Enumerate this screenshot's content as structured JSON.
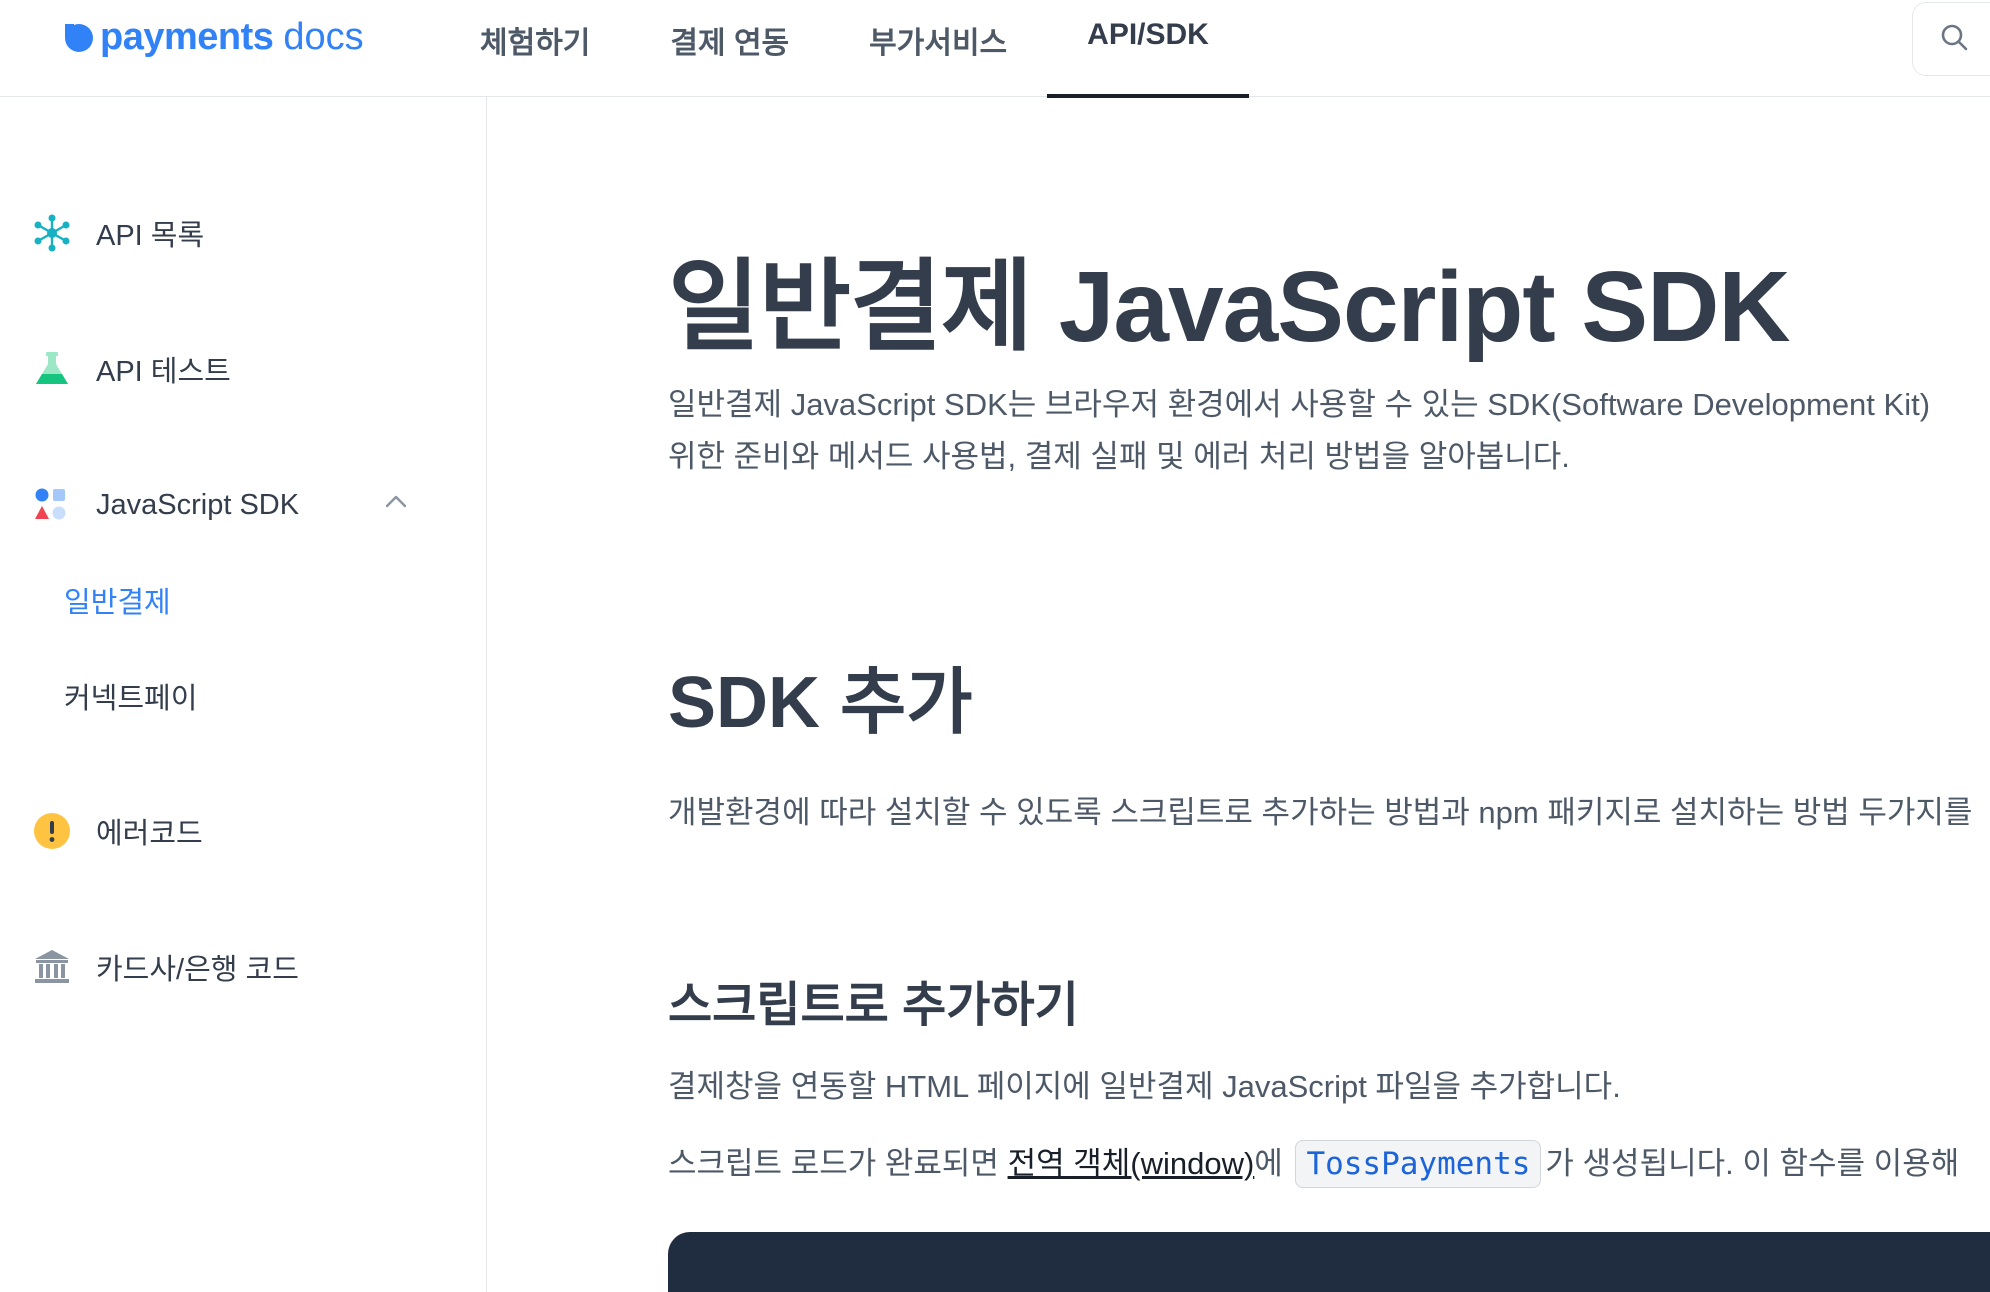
{
  "logo": {
    "word": "payments",
    "suffix": "docs"
  },
  "nav": {
    "tabs": [
      {
        "label": "체험하기"
      },
      {
        "label": "결제 연동"
      },
      {
        "label": "부가서비스"
      },
      {
        "label": "API/SDK",
        "active": true
      }
    ]
  },
  "sidebar": {
    "items": [
      {
        "label": "API 목록",
        "icon": "network-icon"
      },
      {
        "label": "API 테스트",
        "icon": "flask-icon"
      },
      {
        "label": "JavaScript SDK",
        "icon": "shapes-icon",
        "expanded": true
      },
      {
        "label": "에러코드",
        "icon": "warning-icon"
      },
      {
        "label": "카드사/은행 코드",
        "icon": "bank-icon"
      }
    ],
    "sub_items": [
      {
        "label": "일반결제",
        "active": true
      },
      {
        "label": "커넥트페이"
      }
    ]
  },
  "content": {
    "title": "일반결제 JavaScript SDK",
    "intro_line1": "일반결제 JavaScript SDK는 브라우저 환경에서 사용할 수 있는 SDK(Software Development Kit)",
    "intro_line2": "위한 준비와 메서드 사용법, 결제 실패 및 에러 처리 방법을 알아봅니다.",
    "section_title": "SDK 추가",
    "section_text": "개발환경에 따라 설치할 수 있도록 스크립트로 추가하는 방법과 npm 패키지로 설치하는 방법 두가지를",
    "subsection_title": "스크립트로 추가하기",
    "sub_text1": "결제창을 연동할 HTML 페이지에 일반결제 JavaScript 파일을 추가합니다.",
    "sub_text2_pre": "스크립트 로드가 완료되면 ",
    "sub_text2_link": "전역 객체(window)",
    "sub_text2_mid": "에 ",
    "sub_text2_code": "TossPayments",
    "sub_text2_post": "가 생성됩니다. 이 함수를 이용해"
  },
  "colors": {
    "brand": "#3182f6",
    "text_primary": "#333d4b",
    "text_secondary": "#4e5968",
    "border": "#e5e8eb",
    "code_bg": "#202c3f"
  }
}
